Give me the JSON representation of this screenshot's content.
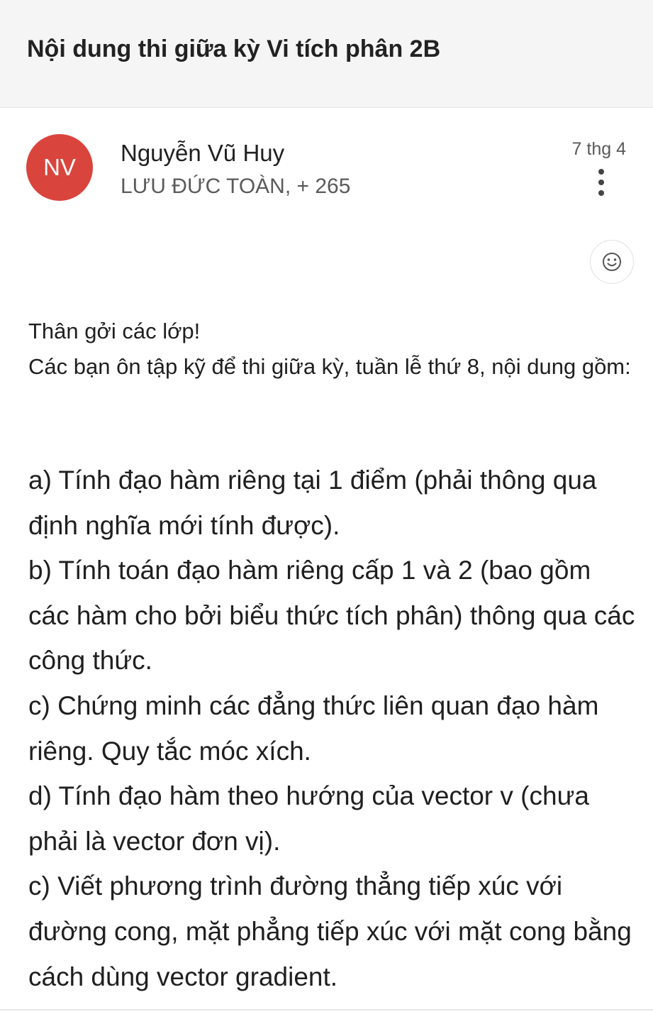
{
  "email": {
    "subject": "Nội dung thi giữa kỳ Vi tích phân 2B",
    "sender": {
      "avatar_initials": "NV",
      "avatar_color": "#d9443c",
      "name": "Nguyễn Vũ Huy",
      "recipients": "LƯU ĐỨC TOÀN, + 265",
      "date": "7 thg 4"
    },
    "icons": {
      "more": "more-vert-icon",
      "react": "smiley-icon"
    },
    "body": {
      "greeting": "Thân gởi các lớp!",
      "intro": "Các bạn ôn tập kỹ để thi giữa kỳ, tuần lễ thứ 8, nội dung gồm:",
      "items": [
        "a) Tính đạo hàm riêng tại 1 điểm (phải thông qua định nghĩa mới tính được).",
        "b) Tính toán đạo hàm riêng cấp 1 và 2 (bao gồm các hàm cho bởi biểu thức tích phân) thông qua các công thức.",
        "c) Chứng minh các đẳng thức liên quan đạo hàm riêng. Quy tắc móc xích.",
        "d) Tính đạo hàm theo hướng của vector v (chưa phải là vector đơn vị).",
        "c) Viết phương trình đường thẳng tiếp xúc với đường cong, mặt phẳng tiếp xúc với mặt cong bằng cách dùng vector gradient."
      ]
    }
  }
}
